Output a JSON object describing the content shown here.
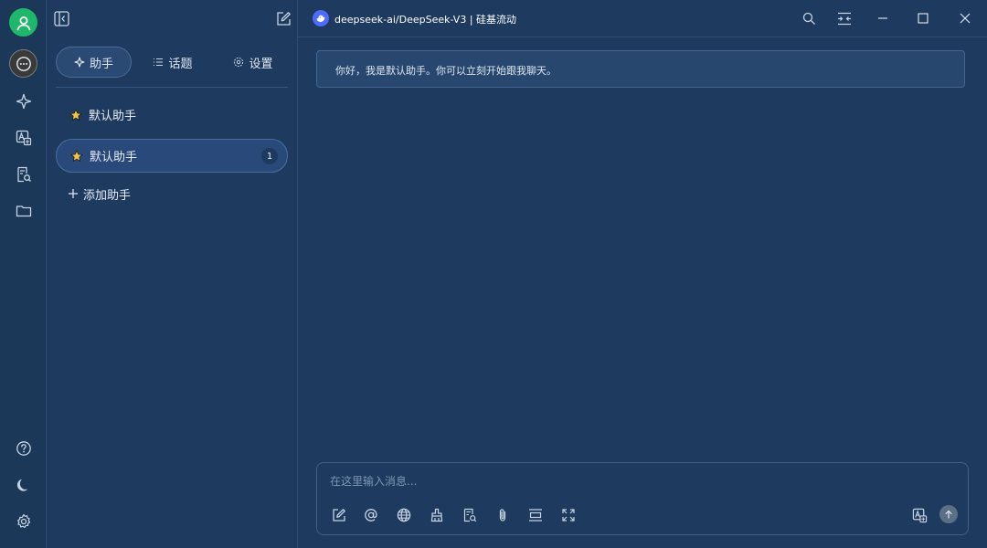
{
  "window": {
    "model_title": "deepseek-ai/DeepSeek-V3 | 硅基流动"
  },
  "rail": {
    "items": [
      {
        "icon": "user-avatar-icon"
      },
      {
        "icon": "chat-bubble-icon",
        "active": true
      },
      {
        "icon": "sparkle-icon"
      },
      {
        "icon": "image-translate-icon"
      },
      {
        "icon": "document-search-icon"
      },
      {
        "icon": "folder-icon"
      },
      {
        "icon": "help-icon"
      },
      {
        "icon": "moon-icon"
      },
      {
        "icon": "gear-icon"
      }
    ]
  },
  "panel": {
    "tabs": [
      {
        "label": "助手",
        "icon": "sparkle-icon",
        "active": true
      },
      {
        "label": "话题",
        "icon": "list-icon"
      },
      {
        "label": "设置",
        "icon": "gear-icon"
      }
    ],
    "assistants": [
      {
        "name": "默认助手",
        "icon": "star-icon"
      },
      {
        "name": "默认助手",
        "icon": "star-icon",
        "selected": true,
        "count": "1"
      }
    ],
    "add_label": "添加助手"
  },
  "chat": {
    "welcome": "你好，我是默认助手。你可以立刻开始跟我聊天。"
  },
  "composer": {
    "placeholder": "在这里输入消息..."
  },
  "colors": {
    "background": "#1e3a5f",
    "avatar": "#1fb86a",
    "star": "#f2c14e",
    "deepseek_logo": "#4d6bfe"
  }
}
